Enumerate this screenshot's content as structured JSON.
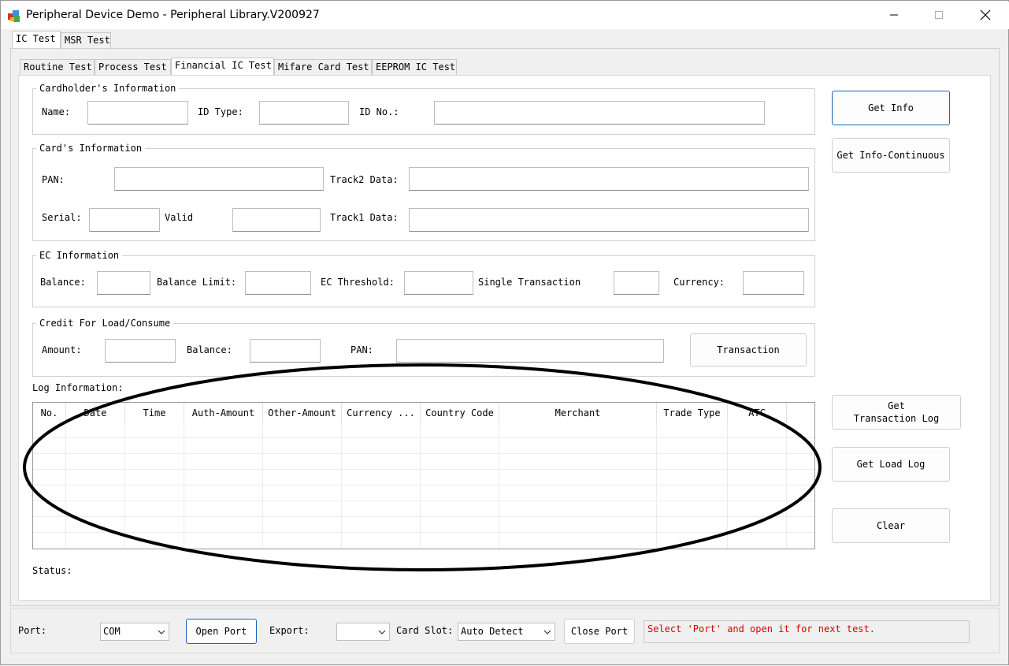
{
  "window": {
    "title": "Peripheral Device Demo - Peripheral Library.V200927"
  },
  "outer_tabs": [
    "IC Test",
    "MSR Test"
  ],
  "inner_tabs": [
    "Routine Test",
    "Process Test",
    "Financial IC Test",
    "Mifare Card Test",
    "EEPROM IC Test"
  ],
  "cardholder": {
    "title": "Cardholder's Information",
    "name_label": "Name:",
    "idtype_label": "ID Type:",
    "idno_label": "ID No.:"
  },
  "card": {
    "title": "Card's Information",
    "pan_label": "PAN:",
    "track2_label": "Track2 Data:",
    "serial_label": "Serial:",
    "valid_label": "Valid",
    "track1_label": "Track1 Data:"
  },
  "ec": {
    "title": "EC Information",
    "balance_label": "Balance:",
    "limit_label": "Balance Limit:",
    "threshold_label": "EC Threshold:",
    "single_label": "Single Transaction",
    "currency_label": "Currency:"
  },
  "credit": {
    "title": "Credit For Load/Consume",
    "amount_label": "Amount:",
    "balance_label": "Balance:",
    "pan_label": "PAN:",
    "transaction_button": "Transaction"
  },
  "buttons": {
    "get_info": "Get Info",
    "get_info_cont": "Get Info-Continuous",
    "get_tx_log_1": "Get",
    "get_tx_log_2": "Transaction Log",
    "get_load_log": "Get Load Log",
    "clear": "Clear"
  },
  "log": {
    "label": "Log Information:",
    "columns": [
      "No.",
      "Date",
      "Time",
      "Auth-Amount",
      "Other-Amount",
      "Currency ...",
      "Country Code",
      "Merchant",
      "Trade Type",
      "ATC"
    ]
  },
  "status_label": "Status:",
  "bottom": {
    "port_label": "Port:",
    "port_value": "COM",
    "open_port": "Open Port",
    "export_label": "Export:",
    "export_value": "",
    "card_slot_label": "Card Slot:",
    "card_slot_value": "Auto Detect",
    "close_port": "Close Port",
    "message": "Select 'Port' and open it for next test."
  },
  "colors": {
    "focus_border": "#1a66b5",
    "message_text": "#e00000",
    "annotation": "#000000"
  },
  "icons": [
    "app-icon",
    "minimize-icon",
    "maximize-icon",
    "close-icon",
    "chevron-down-icon"
  ]
}
